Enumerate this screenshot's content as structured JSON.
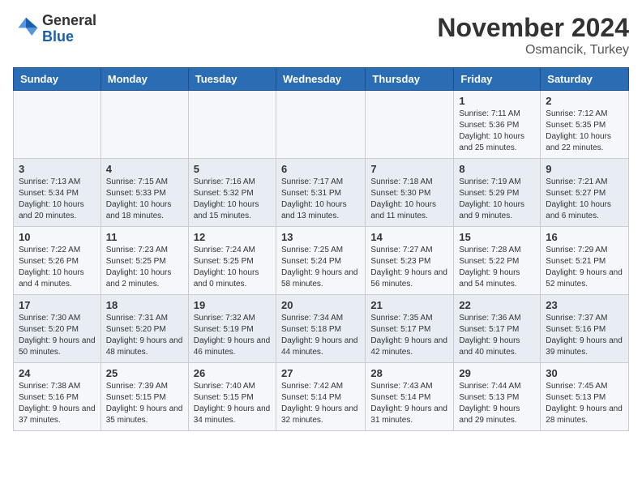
{
  "logo": {
    "general": "General",
    "blue": "Blue"
  },
  "title": "November 2024",
  "location": "Osmancik, Turkey",
  "weekdays": [
    "Sunday",
    "Monday",
    "Tuesday",
    "Wednesday",
    "Thursday",
    "Friday",
    "Saturday"
  ],
  "weeks": [
    [
      {
        "day": "",
        "info": ""
      },
      {
        "day": "",
        "info": ""
      },
      {
        "day": "",
        "info": ""
      },
      {
        "day": "",
        "info": ""
      },
      {
        "day": "",
        "info": ""
      },
      {
        "day": "1",
        "info": "Sunrise: 7:11 AM\nSunset: 5:36 PM\nDaylight: 10 hours and 25 minutes."
      },
      {
        "day": "2",
        "info": "Sunrise: 7:12 AM\nSunset: 5:35 PM\nDaylight: 10 hours and 22 minutes."
      }
    ],
    [
      {
        "day": "3",
        "info": "Sunrise: 7:13 AM\nSunset: 5:34 PM\nDaylight: 10 hours and 20 minutes."
      },
      {
        "day": "4",
        "info": "Sunrise: 7:15 AM\nSunset: 5:33 PM\nDaylight: 10 hours and 18 minutes."
      },
      {
        "day": "5",
        "info": "Sunrise: 7:16 AM\nSunset: 5:32 PM\nDaylight: 10 hours and 15 minutes."
      },
      {
        "day": "6",
        "info": "Sunrise: 7:17 AM\nSunset: 5:31 PM\nDaylight: 10 hours and 13 minutes."
      },
      {
        "day": "7",
        "info": "Sunrise: 7:18 AM\nSunset: 5:30 PM\nDaylight: 10 hours and 11 minutes."
      },
      {
        "day": "8",
        "info": "Sunrise: 7:19 AM\nSunset: 5:29 PM\nDaylight: 10 hours and 9 minutes."
      },
      {
        "day": "9",
        "info": "Sunrise: 7:21 AM\nSunset: 5:27 PM\nDaylight: 10 hours and 6 minutes."
      }
    ],
    [
      {
        "day": "10",
        "info": "Sunrise: 7:22 AM\nSunset: 5:26 PM\nDaylight: 10 hours and 4 minutes."
      },
      {
        "day": "11",
        "info": "Sunrise: 7:23 AM\nSunset: 5:25 PM\nDaylight: 10 hours and 2 minutes."
      },
      {
        "day": "12",
        "info": "Sunrise: 7:24 AM\nSunset: 5:25 PM\nDaylight: 10 hours and 0 minutes."
      },
      {
        "day": "13",
        "info": "Sunrise: 7:25 AM\nSunset: 5:24 PM\nDaylight: 9 hours and 58 minutes."
      },
      {
        "day": "14",
        "info": "Sunrise: 7:27 AM\nSunset: 5:23 PM\nDaylight: 9 hours and 56 minutes."
      },
      {
        "day": "15",
        "info": "Sunrise: 7:28 AM\nSunset: 5:22 PM\nDaylight: 9 hours and 54 minutes."
      },
      {
        "day": "16",
        "info": "Sunrise: 7:29 AM\nSunset: 5:21 PM\nDaylight: 9 hours and 52 minutes."
      }
    ],
    [
      {
        "day": "17",
        "info": "Sunrise: 7:30 AM\nSunset: 5:20 PM\nDaylight: 9 hours and 50 minutes."
      },
      {
        "day": "18",
        "info": "Sunrise: 7:31 AM\nSunset: 5:20 PM\nDaylight: 9 hours and 48 minutes."
      },
      {
        "day": "19",
        "info": "Sunrise: 7:32 AM\nSunset: 5:19 PM\nDaylight: 9 hours and 46 minutes."
      },
      {
        "day": "20",
        "info": "Sunrise: 7:34 AM\nSunset: 5:18 PM\nDaylight: 9 hours and 44 minutes."
      },
      {
        "day": "21",
        "info": "Sunrise: 7:35 AM\nSunset: 5:17 PM\nDaylight: 9 hours and 42 minutes."
      },
      {
        "day": "22",
        "info": "Sunrise: 7:36 AM\nSunset: 5:17 PM\nDaylight: 9 hours and 40 minutes."
      },
      {
        "day": "23",
        "info": "Sunrise: 7:37 AM\nSunset: 5:16 PM\nDaylight: 9 hours and 39 minutes."
      }
    ],
    [
      {
        "day": "24",
        "info": "Sunrise: 7:38 AM\nSunset: 5:16 PM\nDaylight: 9 hours and 37 minutes."
      },
      {
        "day": "25",
        "info": "Sunrise: 7:39 AM\nSunset: 5:15 PM\nDaylight: 9 hours and 35 minutes."
      },
      {
        "day": "26",
        "info": "Sunrise: 7:40 AM\nSunset: 5:15 PM\nDaylight: 9 hours and 34 minutes."
      },
      {
        "day": "27",
        "info": "Sunrise: 7:42 AM\nSunset: 5:14 PM\nDaylight: 9 hours and 32 minutes."
      },
      {
        "day": "28",
        "info": "Sunrise: 7:43 AM\nSunset: 5:14 PM\nDaylight: 9 hours and 31 minutes."
      },
      {
        "day": "29",
        "info": "Sunrise: 7:44 AM\nSunset: 5:13 PM\nDaylight: 9 hours and 29 minutes."
      },
      {
        "day": "30",
        "info": "Sunrise: 7:45 AM\nSunset: 5:13 PM\nDaylight: 9 hours and 28 minutes."
      }
    ]
  ]
}
